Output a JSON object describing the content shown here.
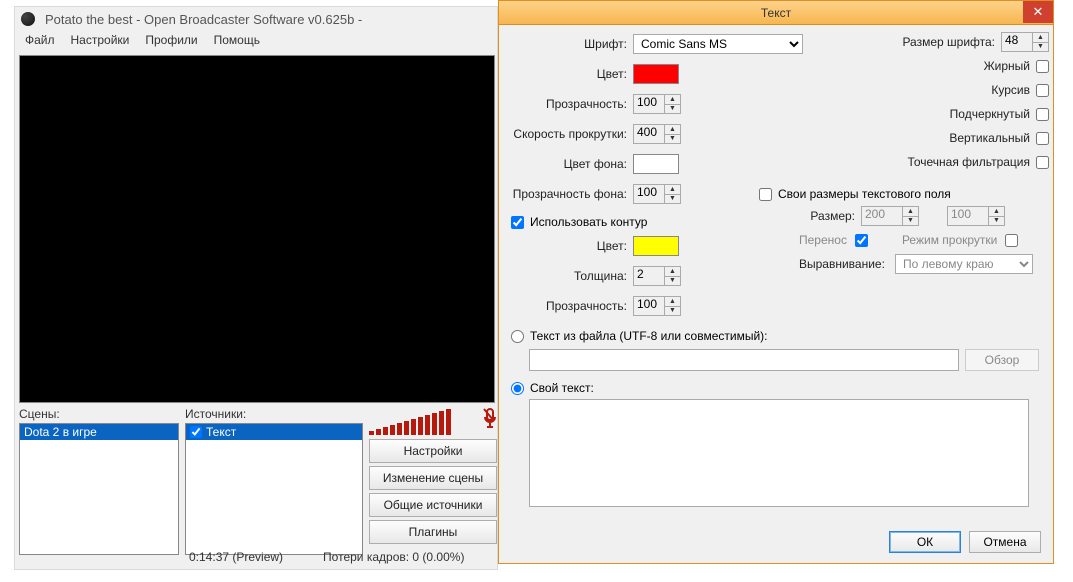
{
  "main": {
    "title": "Potato the best - Open Broadcaster Software v0.625b -",
    "menu": {
      "file": "Файл",
      "settings": "Настройки",
      "profiles": "Профили",
      "help": "Помощь"
    },
    "scenes_label": "Сцены:",
    "sources_label": "Источники:",
    "scene_items": [
      "Dota 2 в игре"
    ],
    "source_items": [
      "Текст"
    ],
    "buttons": {
      "settings": "Настройки",
      "edit_scene": "Изменение сцены",
      "global_sources": "Общие источники",
      "plugins": "Плагины"
    },
    "status_time": "0:14:37 (Preview)",
    "status_drops": "Потери кадров: 0 (0.00%)"
  },
  "dialog": {
    "title": "Текст",
    "labels": {
      "font": "Шрифт:",
      "color": "Цвет:",
      "opacity": "Прозрачность:",
      "scroll_speed": "Скорость прокрутки:",
      "bg_color": "Цвет фона:",
      "bg_opacity": "Прозрачность фона:",
      "use_outline": "Использовать контур",
      "outline_color": "Цвет:",
      "thickness": "Толщина:",
      "outline_opacity": "Прозрачность:",
      "font_size": "Размер шрифта:",
      "bold": "Жирный",
      "italic": "Курсив",
      "underline": "Подчеркнутый",
      "vertical": "Вертикальный",
      "point_filter": "Точечная фильтрация",
      "custom_extents": "Свои размеры текстового поля",
      "size": "Размер:",
      "wrap": "Перенос",
      "scroll_mode": "Режим прокрутки",
      "align": "Выравнивание:",
      "from_file": "Текст из файла (UTF-8 или совместимый):",
      "own_text": "Свой текст:",
      "browse": "Обзор",
      "ok": "ОК",
      "cancel": "Отмена"
    },
    "values": {
      "font": "Comic Sans MS",
      "font_size": "48",
      "color": "#ff0000",
      "opacity": "100",
      "scroll_speed": "400",
      "bg_color": "#ffffff",
      "bg_opacity": "100",
      "outline_color": "#ffff00",
      "thickness": "2",
      "outline_opacity": "100",
      "use_outline": true,
      "custom_extents": false,
      "size_w": "200",
      "size_h": "100",
      "wrap": true,
      "scroll_mode": false,
      "align": "По левому краю",
      "text_mode": "own"
    }
  }
}
